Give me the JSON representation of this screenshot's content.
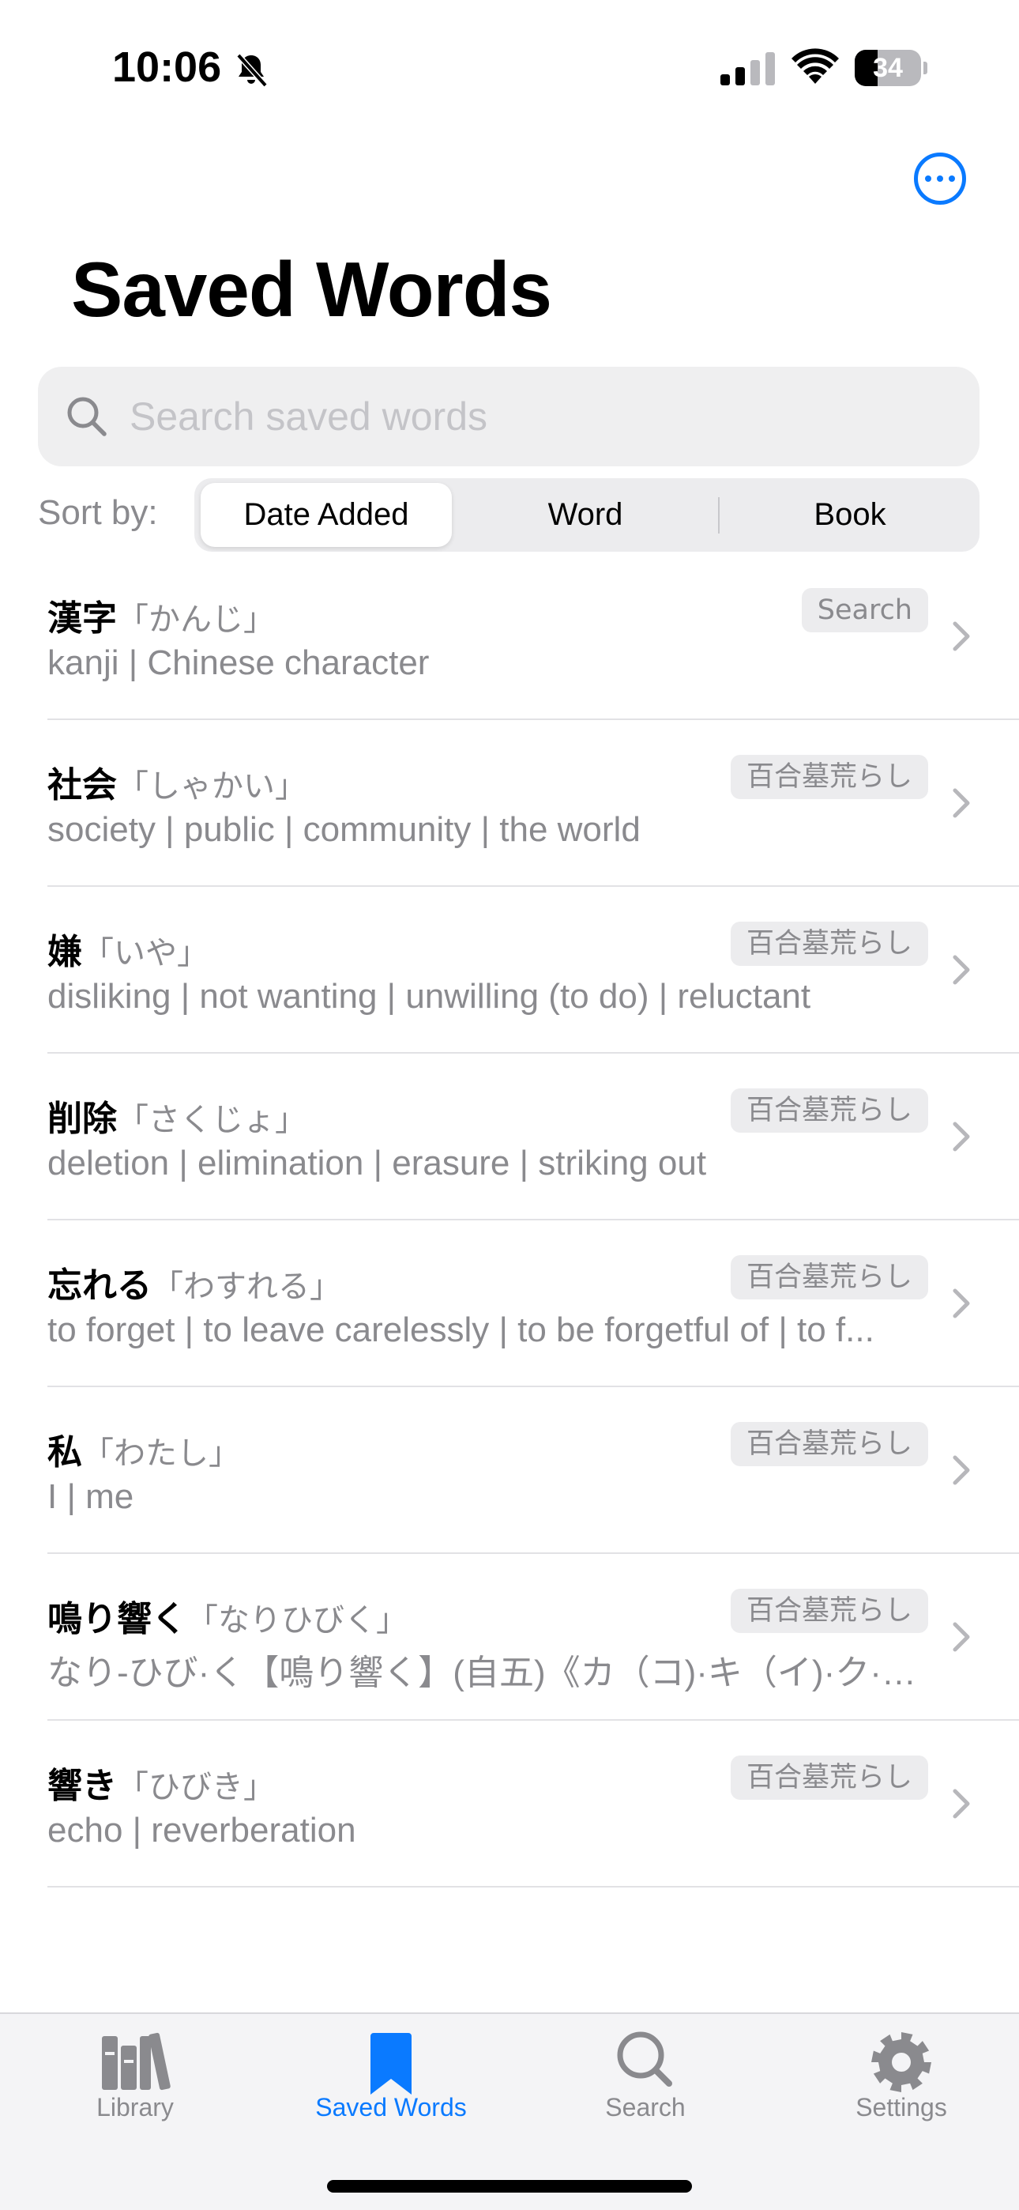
{
  "status_bar": {
    "time": "10:06",
    "battery_level": "34",
    "battery_fraction": 0.34
  },
  "header": {
    "title": "Saved Words",
    "more_icon": "ellipsis-circle-icon"
  },
  "search": {
    "placeholder": "Search saved words",
    "value": ""
  },
  "sort": {
    "label": "Sort by:",
    "options": [
      "Date Added",
      "Word",
      "Book"
    ],
    "selected": "Date Added"
  },
  "words": [
    {
      "word": "漢字",
      "reading": "「かんじ」",
      "definition": "kanji | Chinese character",
      "source": "Search"
    },
    {
      "word": "社会",
      "reading": "「しゃかい」",
      "definition": "society | public | community | the world",
      "source": "百合墓荒らし"
    },
    {
      "word": "嫌",
      "reading": "「いや」",
      "definition": "disliking | not wanting | unwilling (to do) | reluctant",
      "source": "百合墓荒らし"
    },
    {
      "word": "削除",
      "reading": "「さくじょ」",
      "definition": "deletion | elimination | erasure | striking out",
      "source": "百合墓荒らし"
    },
    {
      "word": "忘れる",
      "reading": "「わすれる」",
      "definition": "to forget | to leave carelessly | to be forgetful of | to f...",
      "source": "百合墓荒らし"
    },
    {
      "word": "私",
      "reading": "「わたし」",
      "definition": "I | me",
      "source": "百合墓荒らし"
    },
    {
      "word": "鳴り響く",
      "reading": "「なりひびく」",
      "definition": "なり‐ひび·く【鳴り響く】(自五)《カ（コ)·キ（イ)·ク·ク·ケ·...",
      "source": "百合墓荒らし"
    },
    {
      "word": "響き",
      "reading": "「ひびき」",
      "definition": "echo | reverberation",
      "source": "百合墓荒らし"
    }
  ],
  "tabs": [
    {
      "label": "Library",
      "icon": "books-icon",
      "active": false
    },
    {
      "label": "Saved Words",
      "icon": "bookmark-icon",
      "active": true
    },
    {
      "label": "Search",
      "icon": "search-icon",
      "active": false
    },
    {
      "label": "Settings",
      "icon": "gear-icon",
      "active": false
    }
  ],
  "colors": {
    "accent": "#0a7aff",
    "secondary_text": "#8a8a8e",
    "tab_inactive": "#8a8a8e"
  }
}
